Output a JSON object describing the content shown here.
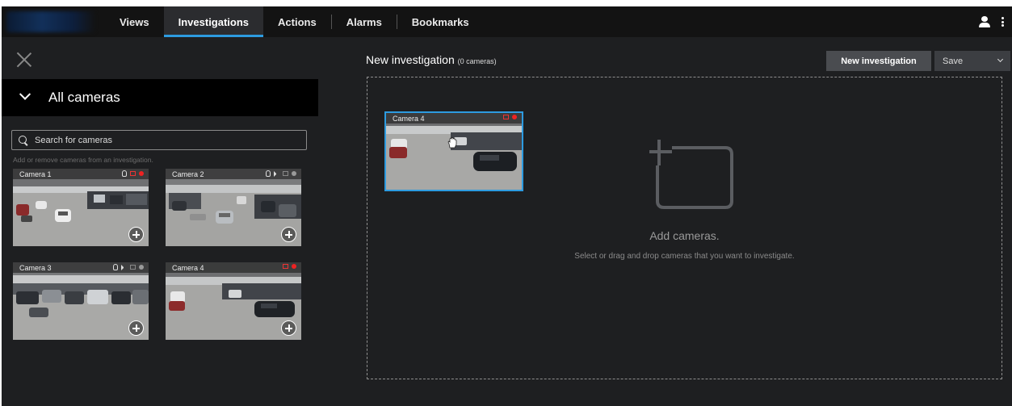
{
  "nav": {
    "tabs": [
      {
        "label": "Views"
      },
      {
        "label": "Investigations"
      },
      {
        "label": "Actions"
      },
      {
        "label": "Alarms"
      },
      {
        "label": "Bookmarks"
      }
    ],
    "active_tab": "Investigations",
    "accent_color": "#2d9be0"
  },
  "left_panel": {
    "group_label": "All cameras",
    "search_placeholder": "Search for cameras",
    "hint": "Add or remove cameras from an investigation.",
    "cameras": [
      {
        "name": "Camera 1",
        "indicators": [
          "microphone-icon",
          "recording-icon",
          "recording-dot"
        ]
      },
      {
        "name": "Camera 2",
        "indicators": [
          "microphone-icon",
          "speaker-icon",
          "idle-icon",
          "idle-dot"
        ]
      },
      {
        "name": "Camera 3",
        "indicators": [
          "microphone-icon",
          "speaker-icon",
          "idle-icon",
          "idle-dot"
        ]
      },
      {
        "name": "Camera 4",
        "indicators": [
          "recording-icon",
          "recording-dot"
        ]
      }
    ]
  },
  "investigation": {
    "title": "New investigation",
    "count_label": "(0 cameras)",
    "new_button": "New investigation",
    "save_button": "Save",
    "dragged_camera": "Camera 4",
    "empty_title": "Add cameras.",
    "empty_subtitle": "Select or drag and drop cameras that you want to investigate."
  }
}
